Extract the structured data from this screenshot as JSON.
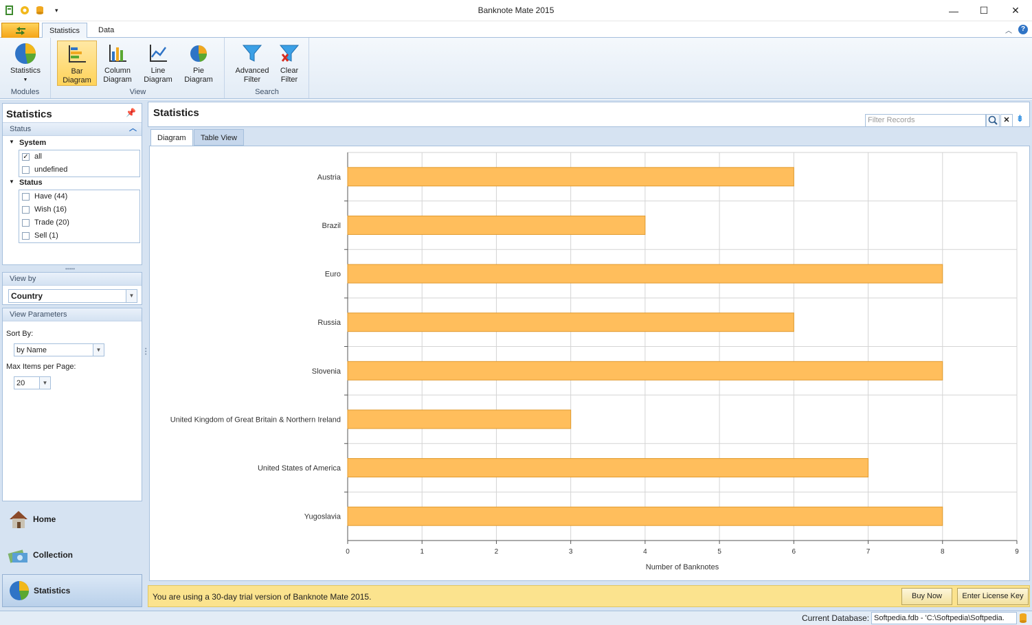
{
  "window": {
    "title": "Banknote Mate 2015",
    "minimize_icon": "minimize-icon",
    "maximize_icon": "maximize-icon",
    "close_icon": "close-icon"
  },
  "ribbon": {
    "tabs": [
      "Statistics",
      "Data"
    ],
    "groups": [
      {
        "label": "Modules",
        "buttons": [
          {
            "label": "Statistics",
            "icon": "pie-chart-icon"
          }
        ]
      },
      {
        "label": "View",
        "buttons": [
          {
            "label": "Bar\nDiagram",
            "icon": "bar-diagram-icon"
          },
          {
            "label": "Column\nDiagram",
            "icon": "column-diagram-icon"
          },
          {
            "label": "Line\nDiagram",
            "icon": "line-diagram-icon"
          },
          {
            "label": "Pie\nDiagram",
            "icon": "pie-diagram-icon"
          }
        ]
      },
      {
        "label": "Search",
        "buttons": [
          {
            "label": "Advanced\nFilter",
            "icon": "funnel-icon"
          },
          {
            "label": "Clear\nFilter",
            "icon": "clear-funnel-icon"
          }
        ]
      }
    ]
  },
  "left": {
    "title": "Statistics",
    "status_header": "Status",
    "system_group": "System",
    "system_items": [
      {
        "label": "all",
        "checked": true
      },
      {
        "label": "undefined",
        "checked": false
      }
    ],
    "status_group": "Status",
    "status_items": [
      {
        "label": "Have (44)"
      },
      {
        "label": "Wish (16)"
      },
      {
        "label": "Trade (20)"
      },
      {
        "label": "Sell (1)"
      }
    ],
    "view_by_header": "View by",
    "view_by_value": "Country",
    "params_header": "View Parameters",
    "sort_by_label": "Sort By:",
    "sort_by_value": "by Name",
    "max_items_label": "Max Items per Page:",
    "max_items_value": "20",
    "nav": [
      {
        "label": "Home",
        "icon": "home-icon"
      },
      {
        "label": "Collection",
        "icon": "banknotes-icon"
      },
      {
        "label": "Statistics",
        "icon": "pie-chart-icon"
      }
    ]
  },
  "main": {
    "title": "Statistics",
    "filter_placeholder": "Filter Records",
    "view_tabs": [
      "Diagram",
      "Table View"
    ],
    "trial_text": "You are using a 30-day trial version of Banknote Mate 2015.",
    "buy_label": "Buy Now",
    "license_label": "Enter License Key"
  },
  "status": {
    "db_label": "Current Database:",
    "db_value": "Softpedia.fdb - 'C:\\Softpedia\\Softpedia."
  },
  "colors": {
    "bar_fill": "#ffbe5c",
    "bar_stroke": "#e09a2e",
    "accent": "#a5bfdc"
  },
  "chart_data": {
    "type": "bar",
    "orientation": "horizontal",
    "categories": [
      "Austria",
      "Brazil",
      "Euro",
      "Russia",
      "Slovenia",
      "United Kingdom of Great Britain & Northern Ireland",
      "United States of America",
      "Yugoslavia"
    ],
    "values": [
      6,
      4,
      8,
      6,
      8,
      3,
      7,
      8
    ],
    "xlabel": "Number of Banknotes",
    "xlim": [
      0,
      9
    ],
    "xticks": [
      "0",
      "1",
      "2",
      "3",
      "4",
      "5",
      "6",
      "7",
      "8",
      "9"
    ],
    "grid": true
  }
}
